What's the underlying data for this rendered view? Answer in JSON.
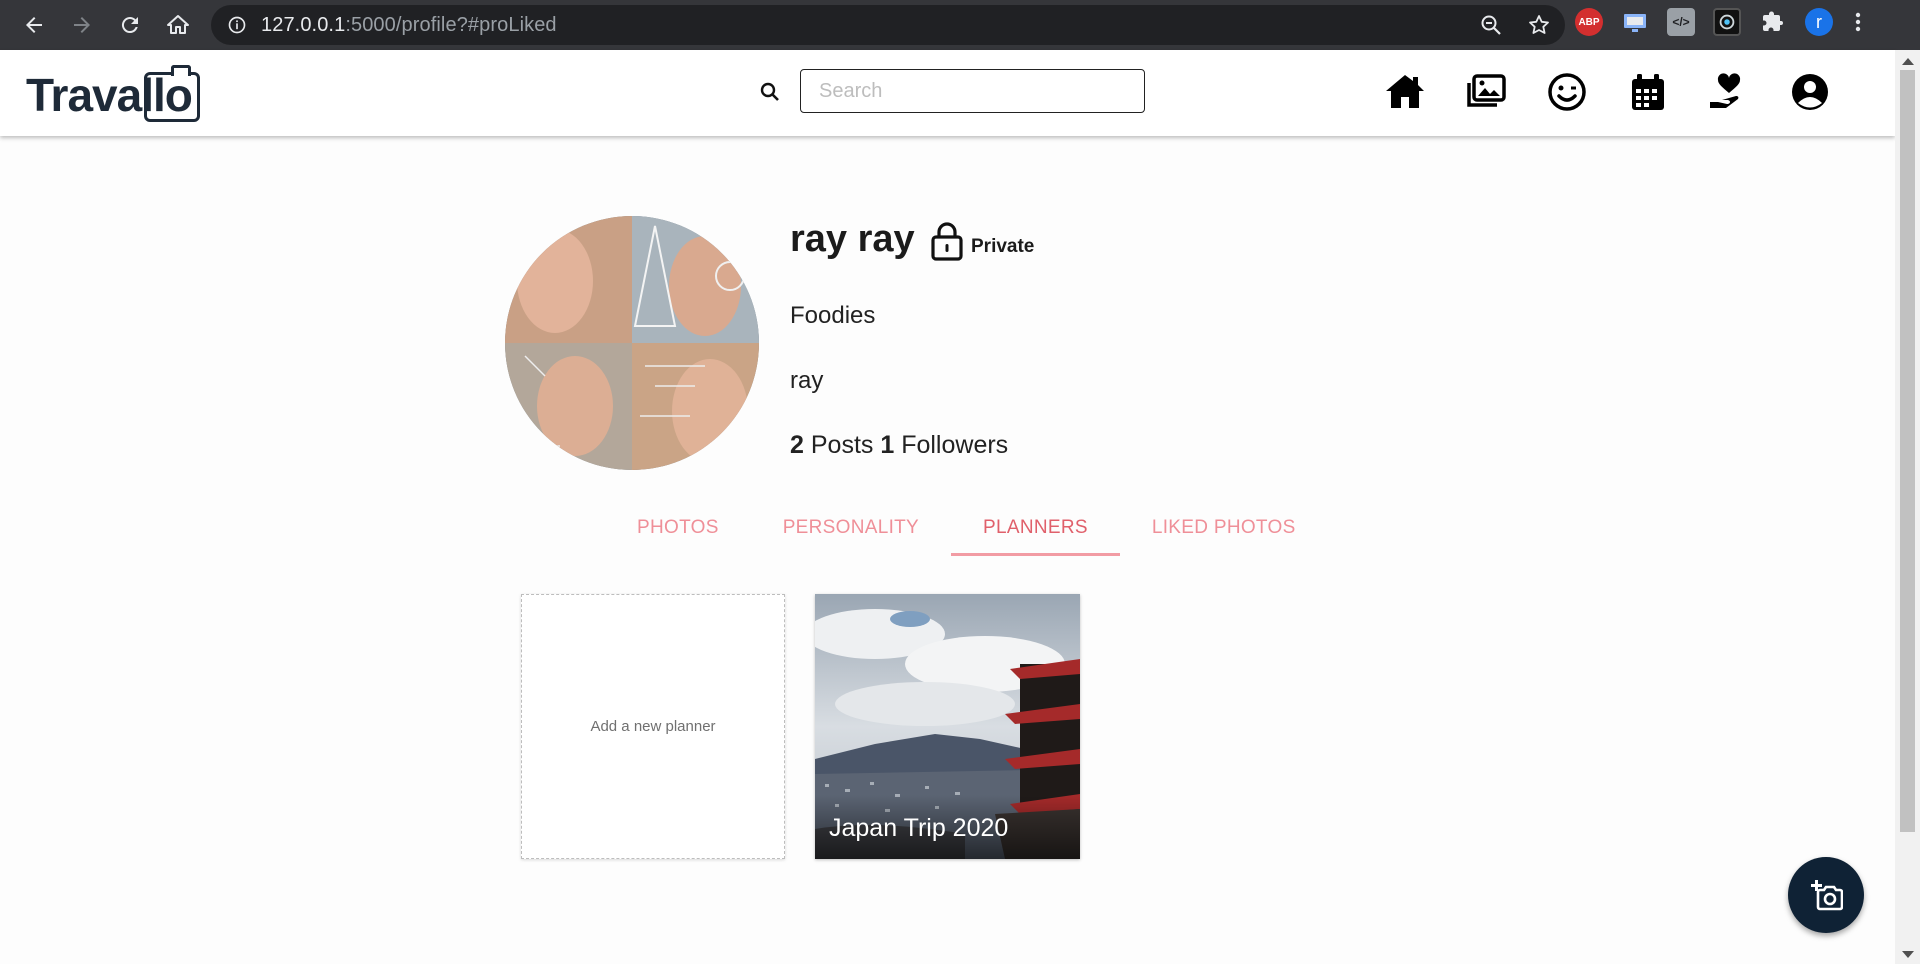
{
  "browser": {
    "url_host": "127.0.0.1",
    "url_rest": ":5000/profile?#proLiked",
    "avatar_letter": "r",
    "ext_abp": "ABP",
    "ext_code": "</>"
  },
  "header": {
    "logo": "Travallo",
    "search_placeholder": "Search",
    "nav_icons": [
      "home-icon",
      "gallery-icon",
      "personality-icon",
      "calendar-icon",
      "donate-icon",
      "account-icon"
    ]
  },
  "profile": {
    "name": "ray ray",
    "privacy": "Private",
    "category": "Foodies",
    "bio": "ray",
    "posts_count": "2",
    "posts_label": "Posts",
    "followers_count": "1",
    "followers_label": "Followers"
  },
  "tabs": [
    {
      "label": "PHOTOS",
      "active": false
    },
    {
      "label": "PERSONALITY",
      "active": false
    },
    {
      "label": "PLANNERS",
      "active": true
    },
    {
      "label": "LIKED PHOTOS",
      "active": false
    }
  ],
  "planners": {
    "add_label": "Add a new planner",
    "items": [
      {
        "title": "Japan Trip 2020"
      }
    ]
  },
  "colors": {
    "tab_text": "#ef8f98",
    "tab_active": "#e0606b",
    "fab_bg": "#0f2235",
    "logo": "#1e2a38"
  }
}
